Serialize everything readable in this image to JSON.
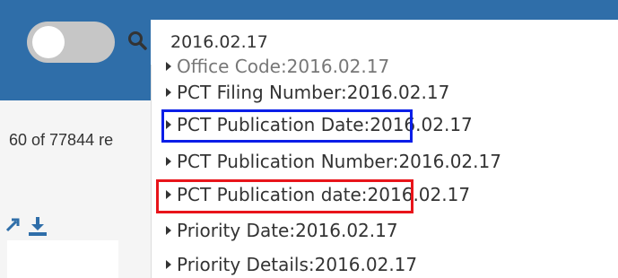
{
  "header": {
    "search_value": "2016.02.17",
    "background_color": "#2f6ea9",
    "toggle_color": "#c6c6c6",
    "search_icon": "search-icon"
  },
  "results": {
    "count_text": "60 of 77844 re"
  },
  "toolbar": {
    "share_icon": "external-link-icon",
    "download_icon": "download-icon",
    "icon_color": "#2f6ea9"
  },
  "suggestions": [
    {
      "label": "Office Code:2016.02.17"
    },
    {
      "label": "PCT Filing Number:2016.02.17"
    },
    {
      "label": "PCT Publication Date:2016.02.17"
    },
    {
      "label": "PCT Publication Number:2016.02.17"
    },
    {
      "label": "PCT Publication date:2016.02.17"
    },
    {
      "label": "Priority Date:2016.02.17"
    },
    {
      "label": "Priority Details:2016.02.17"
    }
  ],
  "annotations": {
    "blue_box_color": "#0a1ee8",
    "red_box_color": "#e8141a"
  }
}
